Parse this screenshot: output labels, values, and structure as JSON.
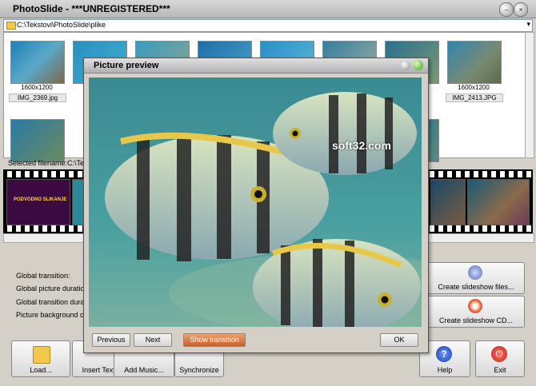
{
  "window": {
    "title": "PhotoSlide - ***UNREGISTERED***"
  },
  "path": "C:\\Tekstovi\\PhotoSlide\\plike",
  "thumbnails": [
    {
      "size": "1600x1200",
      "name": "IMG_2369.jpg"
    },
    {
      "size": "",
      "name": ""
    },
    {
      "size": "",
      "name": ""
    },
    {
      "size": "",
      "name": ""
    },
    {
      "size": "",
      "name": ""
    },
    {
      "size": "",
      "name": ""
    },
    {
      "size": "",
      "name": ""
    },
    {
      "size": "1600x1200",
      "name": "IMG_2413.JPG"
    }
  ],
  "selected_filename": "Selected filename:C:\\Teksto",
  "filmstrip": {
    "first_frame_text": "PODVODNO SLIKANJE"
  },
  "settings": {
    "global_transition": "Global transition:",
    "global_picture_duration": "Global picture duration:",
    "global_transition_duration": "Global transition duration:",
    "picture_background_color": "Picture background color:"
  },
  "side_buttons": {
    "create_files": "Create slideshow files...",
    "create_cd": "Create slideshow CD..."
  },
  "bottom_buttons": {
    "load": "Load...",
    "insert_text": "Insert Text...",
    "add_music": "Add Music...",
    "synchronize": "Synchronize",
    "help": "Help",
    "exit": "Exit"
  },
  "preview": {
    "title": "Picture preview",
    "previous": "Previous",
    "next": "Next",
    "show_transition": "Show transition",
    "ok": "OK"
  },
  "watermark": "soft32.com",
  "colors": {
    "accent_orange": "#d9773f",
    "film_black": "#000000"
  }
}
